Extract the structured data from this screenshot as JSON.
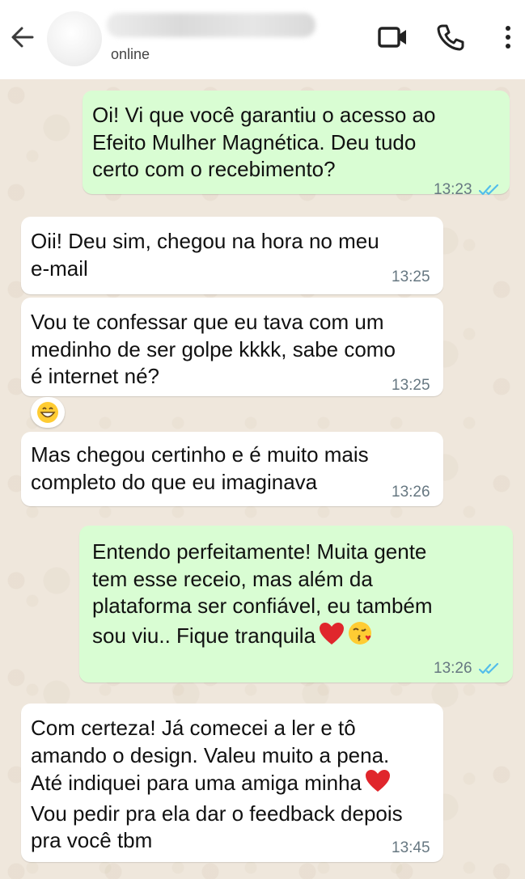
{
  "header": {
    "status": "online"
  },
  "messages": [
    {
      "direction": "out",
      "text": "Oi! Vi que você garantiu o acesso ao\nEfeito Mulher Magnética. Deu tudo\ncerto com o recebimento?",
      "time": "13:23"
    },
    {
      "direction": "in",
      "text": "Oii! Deu sim, chegou na hora no meu\ne-mail",
      "time": "13:25"
    },
    {
      "direction": "in",
      "text": "Vou te confessar que eu tava com um\nmedinho de ser golpe kkkk, sabe como\né internet né?",
      "time": "13:25",
      "reaction": "grinning-face"
    },
    {
      "direction": "in",
      "text": "Mas chegou certinho e é muito mais\ncompleto do que eu imaginava",
      "time": "13:26"
    },
    {
      "direction": "out",
      "text": "Entendo perfeitamente! Muita gente\ntem esse receio, mas além da\nplataforma ser confiável, eu também\nsou viu.. Fique tranquila",
      "time": "13:26"
    },
    {
      "direction": "in",
      "text": "Com certeza! Já comecei a ler e tô\namando o design. Valeu muito a pena.\nAté indiquei para uma amiga minha",
      "text2": "Vou pedir pra ela dar o feedback depois\npra você tbm",
      "time": "13:45"
    }
  ],
  "colors": {
    "outgoing_bubble": "#d9fdd3",
    "incoming_bubble": "#ffffff",
    "read_ticks": "#53bdeb",
    "chat_background": "#efe7dc"
  },
  "icons": [
    "back-arrow-icon",
    "video-call-icon",
    "phone-icon",
    "more-options-icon",
    "double-check-icon",
    "red-heart-icon",
    "kiss-face-icon",
    "grinning-face-icon"
  ]
}
